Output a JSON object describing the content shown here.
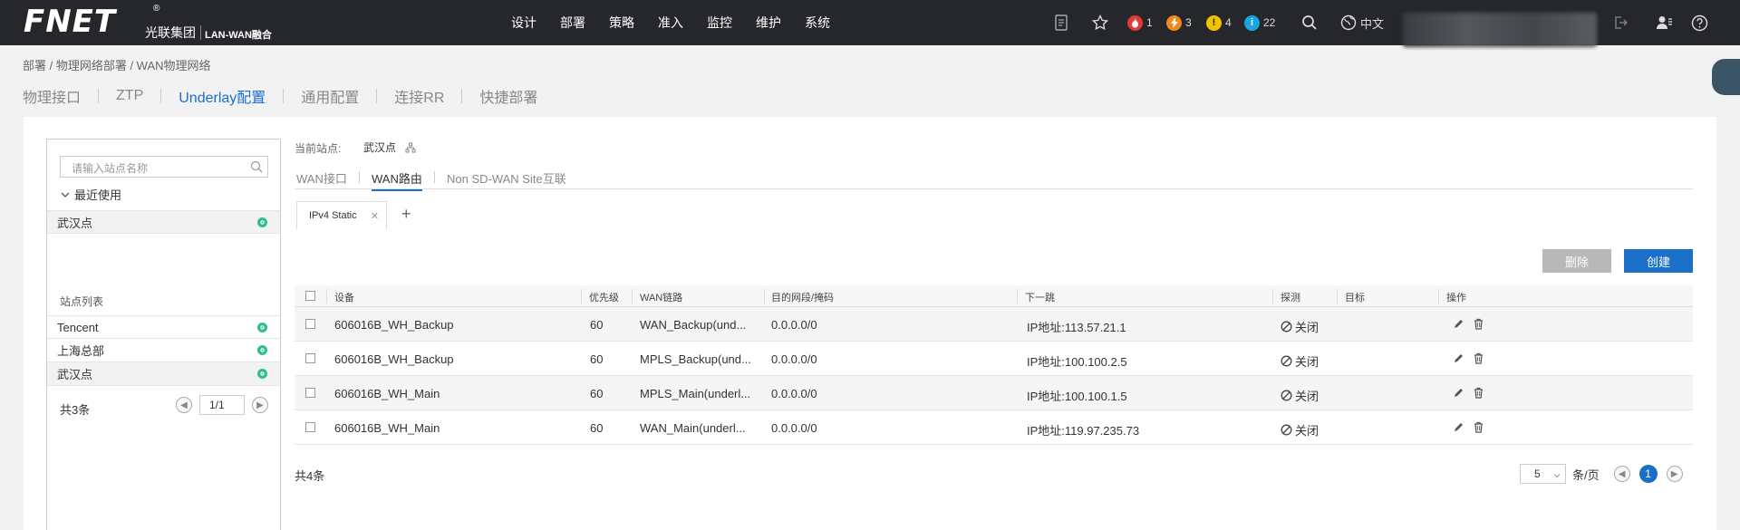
{
  "header": {
    "logo_text": "FNET",
    "logo_reg": "®",
    "logo_cn": "光联集团",
    "product": "LAN-WAN融合",
    "nav": [
      "设计",
      "部署",
      "策略",
      "准入",
      "监控",
      "维护",
      "系统"
    ],
    "alarms": [
      {
        "count": "1",
        "color": "#e03a3a",
        "icon": "fire-icon"
      },
      {
        "count": "3",
        "color": "#f08a1c",
        "icon": "lightning-icon"
      },
      {
        "count": "4",
        "color": "#f2c200",
        "icon": "exclamation-icon"
      },
      {
        "count": "22",
        "color": "#19a6e0",
        "icon": "info-icon"
      }
    ],
    "language": "中文"
  },
  "breadcrumb": "部署 / 物理网络部署 / WAN物理网络",
  "top_tabs": [
    "物理接口",
    "ZTP",
    "Underlay配置",
    "通用配置",
    "连接RR",
    "快捷部署"
  ],
  "active_top_tab": "Underlay配置",
  "left_panel": {
    "search_placeholder": "请输入站点名称",
    "recent_label": "最近使用",
    "recent_items": [
      "武汉点"
    ],
    "list_label": "站点列表",
    "sites": [
      "Tencent",
      "上海总部",
      "武汉点"
    ],
    "total": "共3条",
    "page": "1/1"
  },
  "current_site": {
    "label": "当前站点:",
    "value": "武汉点"
  },
  "sub_tabs": [
    "WAN接口",
    "WAN路由",
    "Non SD-WAN Site互联"
  ],
  "active_sub_tab": "WAN路由",
  "route_tab": "IPv4 Static",
  "buttons": {
    "delete": "删除",
    "create": "创建"
  },
  "table": {
    "headers": [
      "设备",
      "优先级",
      "WAN链路",
      "目的网段/掩码",
      "下一跳",
      "探测",
      "目标",
      "操作"
    ],
    "rows": [
      {
        "device": "606016B_WH_Backup",
        "priority": "60",
        "wan_link": "WAN_Backup(und...",
        "dest": "0.0.0.0/0",
        "next_hop": "IP地址:113.57.21.1",
        "probe": "关闭",
        "target": ""
      },
      {
        "device": "606016B_WH_Backup",
        "priority": "60",
        "wan_link": "MPLS_Backup(und...",
        "dest": "0.0.0.0/0",
        "next_hop": "IP地址:100.100.2.5",
        "probe": "关闭",
        "target": ""
      },
      {
        "device": "606016B_WH_Main",
        "priority": "60",
        "wan_link": "MPLS_Main(underl...",
        "dest": "0.0.0.0/0",
        "next_hop": "IP地址:100.100.1.5",
        "probe": "关闭",
        "target": ""
      },
      {
        "device": "606016B_WH_Main",
        "priority": "60",
        "wan_link": "WAN_Main(underl...",
        "dest": "0.0.0.0/0",
        "next_hop": "IP地址:119.97.235.73",
        "probe": "关闭",
        "target": ""
      }
    ]
  },
  "pagination": {
    "total": "共4条",
    "page_size": "5",
    "per_page_label": "条/页",
    "current_page": "1"
  }
}
